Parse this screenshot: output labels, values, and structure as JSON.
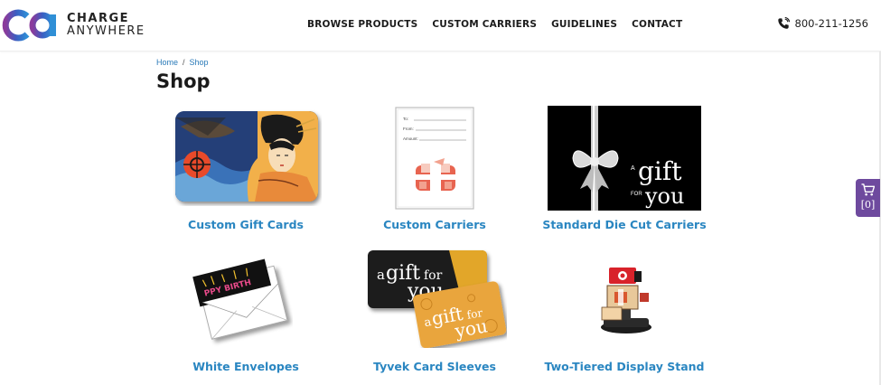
{
  "brand": {
    "line1": "CHARGE",
    "line2": "ANYWHERE",
    "logo_mark": "CA"
  },
  "nav": [
    {
      "label": "BROWSE PRODUCTS"
    },
    {
      "label": "CUSTOM CARRIERS"
    },
    {
      "label": "GUIDELINES"
    },
    {
      "label": "CONTACT"
    }
  ],
  "phone": {
    "icon": "phone-icon",
    "number": "800-211-1256"
  },
  "breadcrumb": {
    "home": "Home",
    "separator": "/",
    "current": "Shop"
  },
  "page": {
    "title": "Shop"
  },
  "products": [
    {
      "name": "Custom Gift Cards",
      "image": "geisha-art-gift-card"
    },
    {
      "name": "Custom Carriers",
      "image": "carrier-form-with-gift-box"
    },
    {
      "name": "Standard Die Cut Carriers",
      "image": "black-carrier-silver-bow",
      "image_text": {
        "a": "A",
        "gift": "gift",
        "for": "FOR",
        "you": "you"
      }
    },
    {
      "name": "White Envelopes",
      "image": "envelope-with-birthday-card",
      "image_text": {
        "card": "PPY BIRTH"
      }
    },
    {
      "name": "Tyvek Card Sleeves",
      "image": "a-gift-for-you-cards",
      "image_text": {
        "a": "a",
        "gift": "gift",
        "for": "for",
        "you": "you"
      }
    },
    {
      "name": "Two-Tiered Display Stand",
      "image": "display-stand"
    }
  ],
  "cart": {
    "icon": "cart-icon",
    "count": "[0]"
  },
  "colors": {
    "link": "#2a86c1",
    "brand_purple": "#6e4a9e",
    "brand_blue": "#2f6fbf"
  }
}
